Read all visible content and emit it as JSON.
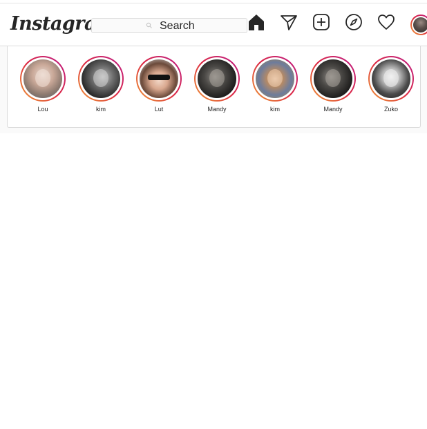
{
  "header": {
    "logo_text": "Instagram",
    "search_placeholder": "Search",
    "nav_icons": [
      "home-icon",
      "direct-message-icon",
      "new-post-icon",
      "explore-icon",
      "activity-heart-icon",
      "profile-avatar"
    ]
  },
  "stories": [
    {
      "name": "Lou"
    },
    {
      "name": "kim"
    },
    {
      "name": "Lut"
    },
    {
      "name": "Mandy"
    },
    {
      "name": "kim"
    },
    {
      "name": "Mandy"
    },
    {
      "name": "Zuko"
    }
  ],
  "colors": {
    "ring_gradient": [
      "#f09433",
      "#e6683c",
      "#dc2743",
      "#cc2366",
      "#bc1888"
    ],
    "border": "#dbdbdb",
    "text": "#262626",
    "feed_background": "#fafafa"
  }
}
